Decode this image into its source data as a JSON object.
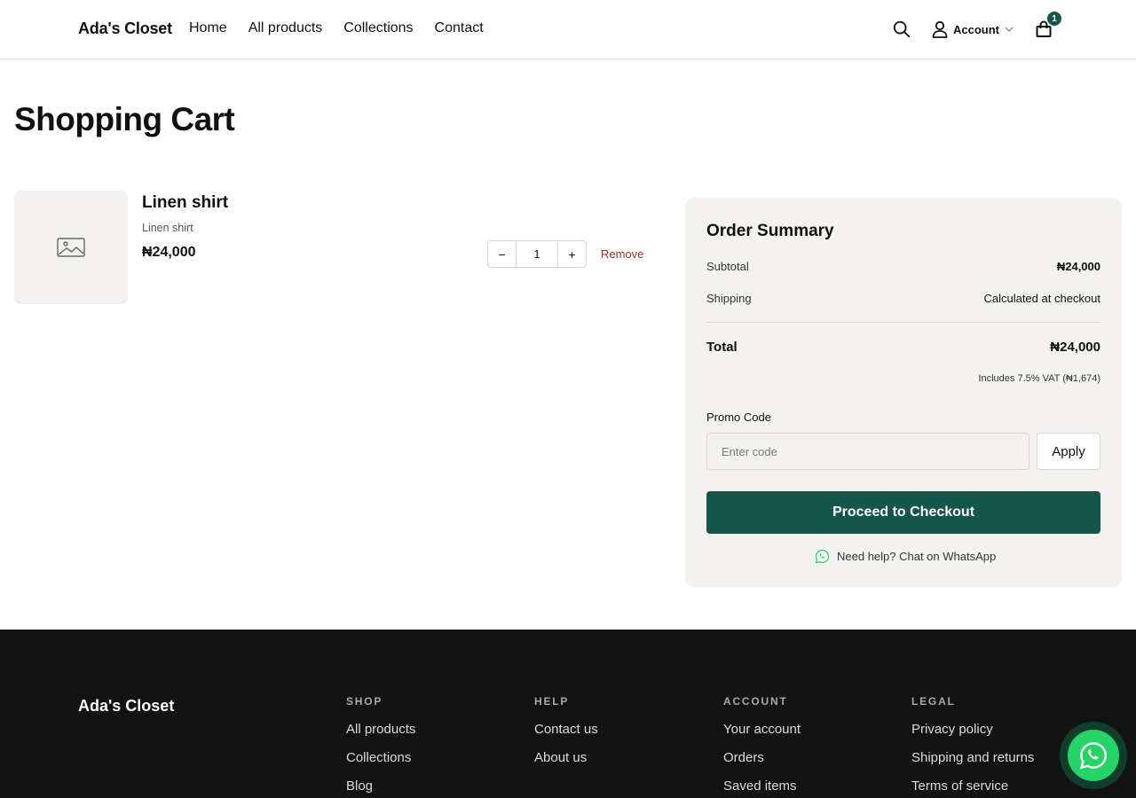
{
  "header": {
    "logo": "Ada's Closet",
    "nav": [
      "Home",
      "All products",
      "Collections",
      "Contact"
    ],
    "account_label": "Account",
    "cart_count": "1"
  },
  "page": {
    "title": "Shopping Cart"
  },
  "cart": {
    "items": [
      {
        "name": "Linen shirt",
        "variant": "Linen shirt",
        "price": "₦24,000",
        "quantity": "1",
        "decrement": "−",
        "increment": "+",
        "remove_label": "Remove"
      }
    ]
  },
  "summary": {
    "title": "Order Summary",
    "subtotal_label": "Subtotal",
    "subtotal_value": "₦24,000",
    "shipping_label": "Shipping",
    "shipping_value": "Calculated at checkout",
    "total_label": "Total",
    "total_value": "₦24,000",
    "vat_note": "Includes 7.5% VAT (₦1,674)",
    "promo_label": "Promo Code",
    "promo_placeholder": "Enter code",
    "apply_label": "Apply",
    "checkout_label": "Proceed to Checkout",
    "help_text": "Need help? Chat on WhatsApp"
  },
  "footer": {
    "logo": "Ada's Closet",
    "columns": [
      {
        "heading": "SHOP",
        "links": [
          "All products",
          "Collections",
          "Blog"
        ]
      },
      {
        "heading": "HELP",
        "links": [
          "Contact us",
          "About us"
        ]
      },
      {
        "heading": "ACCOUNT",
        "links": [
          "Your account",
          "Orders",
          "Saved items"
        ]
      },
      {
        "heading": "LEGAL",
        "links": [
          "Privacy policy",
          "Shipping and returns",
          "Terms of service"
        ]
      }
    ]
  },
  "colors": {
    "accent": "#16564a",
    "remove": "#a6302b",
    "whatsapp": "#25d366",
    "footer_bg": "#131313",
    "panel_bg": "#f3f2ef"
  },
  "icons": [
    "search-icon",
    "user-icon",
    "chevron-down-icon",
    "bag-icon",
    "image-placeholder-icon",
    "whatsapp-icon"
  ]
}
